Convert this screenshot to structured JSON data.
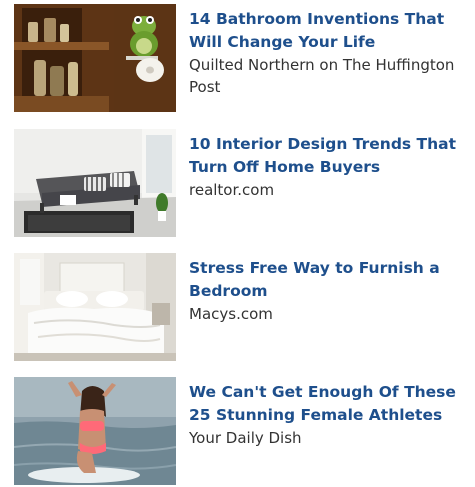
{
  "colors": {
    "title": "#1e4f8c",
    "source": "#333333",
    "background": "#ffffff"
  },
  "items": [
    {
      "title": "14 Bathroom Inventions That Will Change Your Life",
      "source": "Quilted Northern on The Huffington Post",
      "image_icon": "bathroom-frog-toilet-paper-holder-photo"
    },
    {
      "title": "10 Interior Design Trends That Turn Off Home Buyers",
      "source": "realtor.com",
      "image_icon": "gray-daybed-living-room-photo"
    },
    {
      "title": "Stress Free Way to Furnish a Bedroom",
      "source": "Macys.com",
      "image_icon": "white-bedroom-bed-photo"
    },
    {
      "title": "We Can't Get Enough Of These 25 Stunning Female Athletes",
      "source": "Your Daily Dish",
      "image_icon": "surfer-woman-in-water-photo"
    }
  ]
}
